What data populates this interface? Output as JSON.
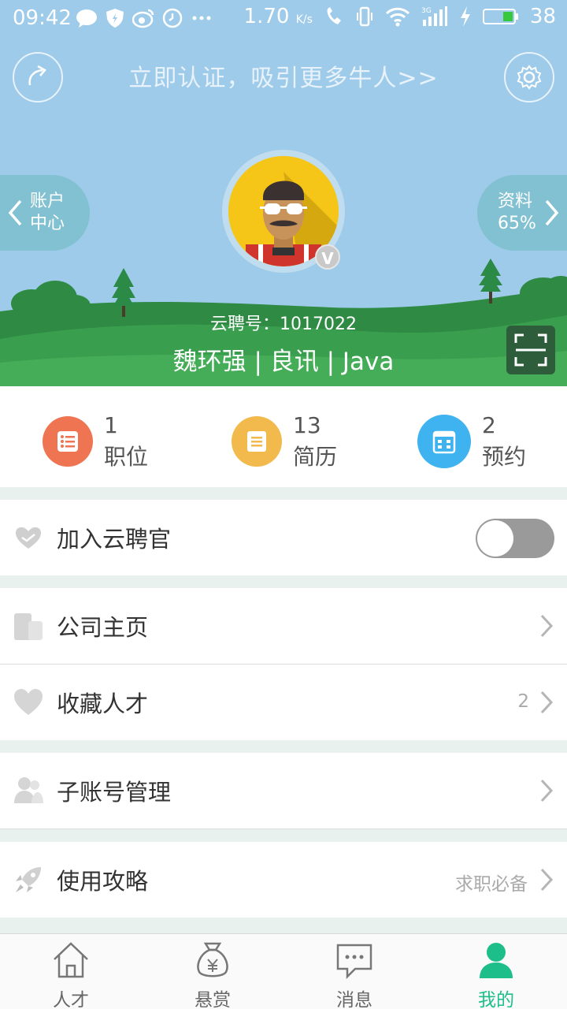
{
  "status_bar": {
    "time": "09:42",
    "speed": "1.70",
    "speed_unit": "K/s",
    "network": "3G",
    "battery": "38"
  },
  "header": {
    "verify_text": "立即认证，吸引更多牛人>>",
    "left_pill": {
      "line1": "账户",
      "line2": "中心"
    },
    "right_pill": {
      "line1": "资料",
      "line2": "65%"
    },
    "badge": "V",
    "yunpin_id": "云聘号：1017022",
    "user_line": "魏环强 | 良讯 | Java"
  },
  "stats": [
    {
      "count": "1",
      "label": "职位",
      "color": "#ef7452",
      "icon": "list-icon"
    },
    {
      "count": "13",
      "label": "简历",
      "color": "#f2b94c",
      "icon": "document-icon"
    },
    {
      "count": "2",
      "label": "预约",
      "color": "#3eb3f0",
      "icon": "calendar-icon"
    }
  ],
  "menu": {
    "join_officer": {
      "label": "加入云聘官",
      "toggle_on": false
    },
    "company_home": {
      "label": "公司主页"
    },
    "saved_talents": {
      "label": "收藏人才",
      "count": "2"
    },
    "sub_accounts": {
      "label": "子账号管理"
    },
    "guide": {
      "label": "使用攻略",
      "hint": "求职必备"
    }
  },
  "tabs": [
    {
      "label": "人才",
      "icon": "house-icon",
      "active": false
    },
    {
      "label": "悬赏",
      "icon": "money-bag-icon",
      "active": false
    },
    {
      "label": "消息",
      "icon": "chat-icon",
      "active": false
    },
    {
      "label": "我的",
      "icon": "person-icon",
      "active": true
    }
  ],
  "colors": {
    "accent": "#1dbe89",
    "sky": "#9ecbe9",
    "grass": "#3a9e4f"
  }
}
